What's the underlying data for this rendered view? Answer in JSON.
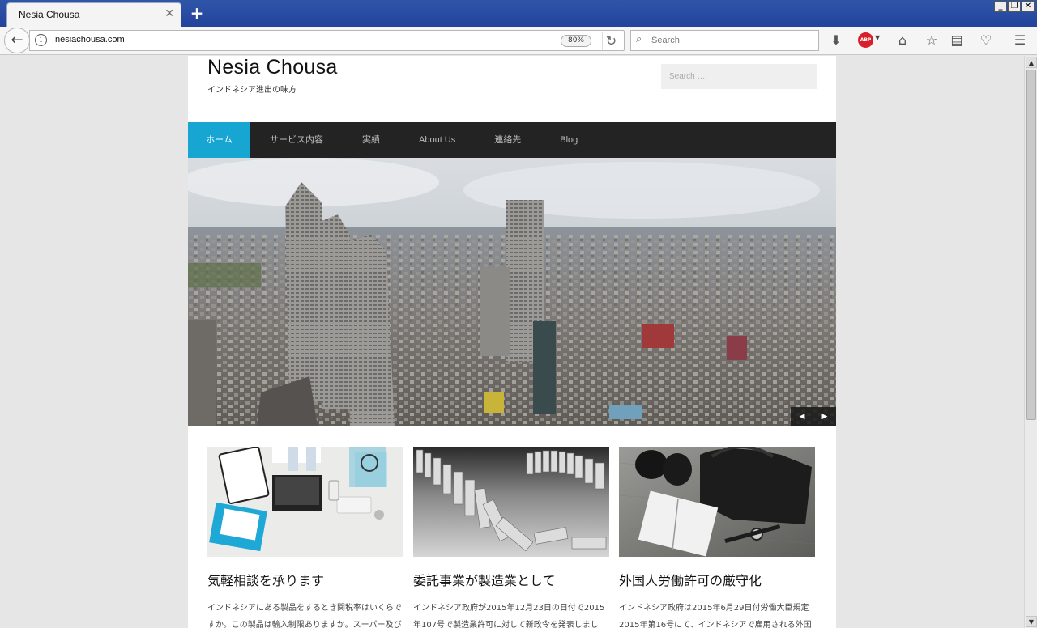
{
  "browser": {
    "tab_title": "Nesia Chousa",
    "url": "nesiachousa.com",
    "zoom": "80%",
    "search_placeholder": "Search"
  },
  "site": {
    "title": "Nesia Chousa",
    "tagline": "インドネシア進出の味方",
    "search_placeholder": "Search …",
    "nav": [
      {
        "label": "ホーム",
        "active": true
      },
      {
        "label": "サービス内容"
      },
      {
        "label": "実績"
      },
      {
        "label": "About Us"
      },
      {
        "label": "連絡先"
      },
      {
        "label": "Blog"
      }
    ],
    "slider": {
      "prev": "◀",
      "next": "▶"
    },
    "cards": [
      {
        "title": "気軽相談を承ります",
        "text": "インドネシアにある製品をするとき関税率はいくらですか。この製品は輸入制限ありますか。スーパー及びコンビニ"
      },
      {
        "title": "委託事業が製造業として",
        "text": "インドネシア政府が2015年12月23日の日付で2015年107号で製造業許可に対して新政令を発表しました。この"
      },
      {
        "title": "外国人労働許可の厳守化",
        "text": "インドネシア政府は2015年6月29日付労働大臣規定2015年第16号にて、インドネシアで雇用される外国人労"
      }
    ]
  },
  "colors": {
    "accent": "#17a5d1",
    "nav_bg": "#232323",
    "abp": "#d8202a"
  }
}
